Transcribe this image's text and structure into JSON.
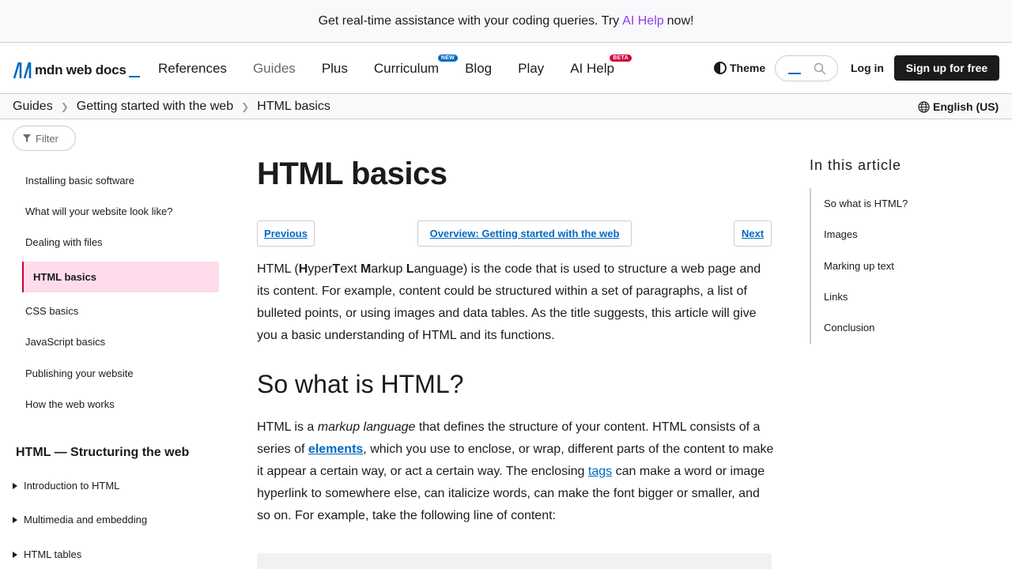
{
  "banner": {
    "text_before": "Get real-time assistance with your coding queries. Try",
    "link": "AI Help",
    "text_after": "now!"
  },
  "header": {
    "logo_text": "mdn web docs",
    "nav": [
      {
        "label": "References"
      },
      {
        "label": "Guides"
      },
      {
        "label": "Plus"
      },
      {
        "label": "Curriculum",
        "badge": "NEW"
      },
      {
        "label": "Blog"
      },
      {
        "label": "Play"
      },
      {
        "label": "AI Help",
        "badge": "BETA"
      }
    ],
    "theme_label": "Theme",
    "login_label": "Log in",
    "signup_label": "Sign up for free"
  },
  "breadcrumb": {
    "items": [
      "Guides",
      "Getting started with the web",
      "HTML basics"
    ],
    "language": "English (US)"
  },
  "sidebar": {
    "filter_label": "Filter",
    "items": [
      "Installing basic software",
      "What will your website look like?",
      "Dealing with files",
      "HTML basics",
      "CSS basics",
      "JavaScript basics",
      "Publishing your website",
      "How the web works"
    ],
    "section_heading": "HTML — Structuring the web",
    "subsections": [
      "Introduction to HTML",
      "Multimedia and embedding",
      "HTML tables"
    ]
  },
  "main": {
    "title": "HTML basics",
    "prev_label": "Previous",
    "overview_label": "Overview: Getting started with the web",
    "next_label": "Next",
    "intro": {
      "t1": "HTML (",
      "b1": "H",
      "t2": "yper",
      "b2": "T",
      "t3": "ext ",
      "b3": "M",
      "t4": "arkup ",
      "b4": "L",
      "t5": "anguage) is the code that is used to structure a web page and its content. For example, content could be structured within a set of paragraphs, a list of bulleted points, or using images and data tables. As the title suggests, this article will give you a basic understanding of HTML and its functions."
    },
    "section_title": "So what is HTML?",
    "para2": {
      "t1": "HTML is a ",
      "em": "markup language",
      "t2": " that defines the structure of your content. HTML consists of a series of ",
      "link1": "elements",
      "t3": ", which you use to enclose, or wrap, different parts of the content to make it appear a certain way, or act a certain way. The enclosing ",
      "link2": "tags",
      "t4": " can make a word or image hyperlink to somewhere else, can italicize words, can make the font bigger or smaller, and so on. For example, take the following line of content:"
    }
  },
  "toc": {
    "title": "In this article",
    "items": [
      "So what is HTML?",
      "Images",
      "Marking up text",
      "Links",
      "Conclusion"
    ]
  },
  "colors": {
    "accent": "#0069c2",
    "ai_link": "#8e3dec",
    "active_bg": "#ffdcec",
    "active_border": "#d30038"
  }
}
